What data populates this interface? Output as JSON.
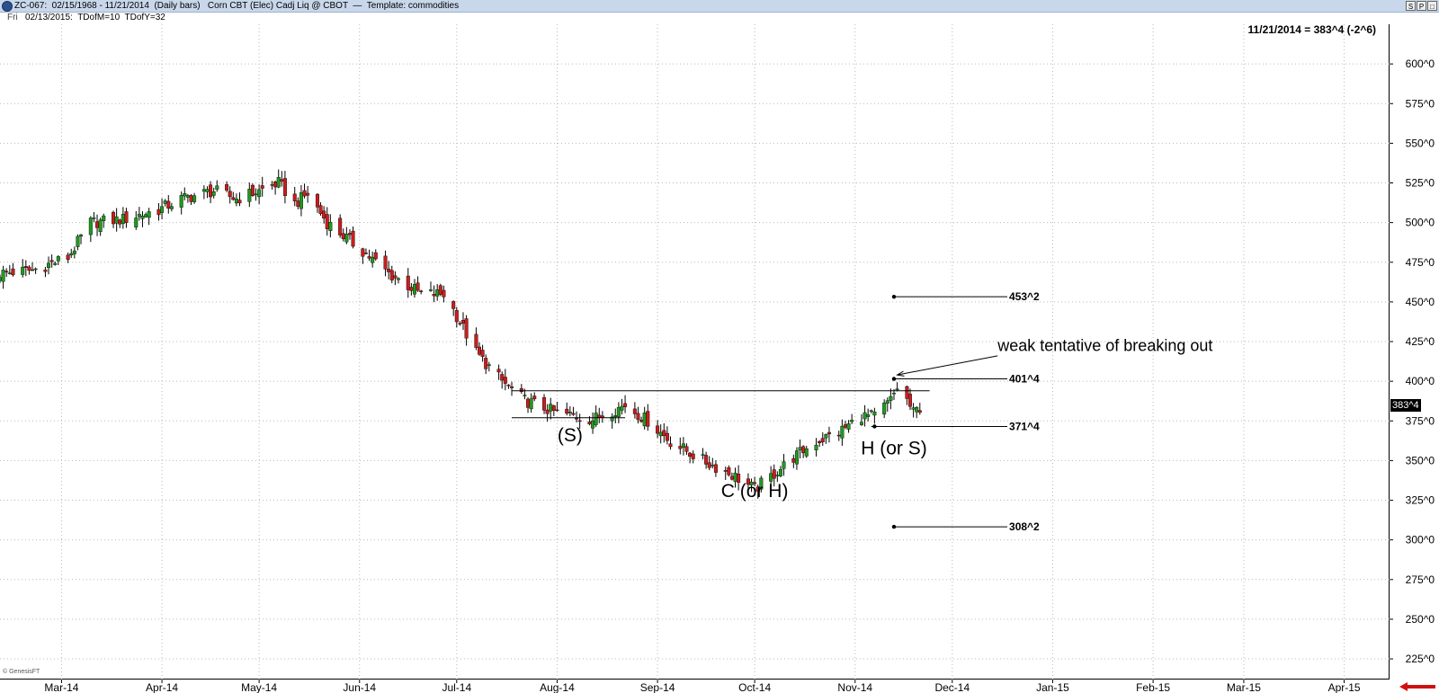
{
  "window": {
    "title": "ZC-067:  02/15/1968 - 11/21/2014  (Daily bars)   Corn CBT (Elec) Cadj Liq @ CBOT  —  Template: commodities",
    "buttons": [
      "S",
      "P",
      "□"
    ]
  },
  "infobar": {
    "day": "Fri",
    "info": "02/13/2015:  TDofM=10  TDofY=32"
  },
  "readout": "11/21/2014 = 383^4 (-2^6)",
  "watermark": "© GenesisFT",
  "last_price_tag": "383^4",
  "colors": {
    "up": "#1f9a1f",
    "down": "#c81e1e",
    "grid": "#b9b9b9",
    "line": "#000000",
    "accent_arrow": "#d01010"
  },
  "chart_data": {
    "type": "candlestick",
    "title": "",
    "xlabel": "",
    "ylabel": "",
    "ylim": [
      212,
      625
    ],
    "y_ticks": [
      "600^0",
      "575^0",
      "550^0",
      "525^0",
      "500^0",
      "475^0",
      "450^0",
      "425^0",
      "400^0",
      "375^0",
      "350^0",
      "325^0",
      "300^0",
      "275^0",
      "250^0",
      "225^0"
    ],
    "y_tick_values": [
      600,
      575,
      550,
      525,
      500,
      475,
      450,
      425,
      400,
      375,
      350,
      325,
      300,
      275,
      250,
      225
    ],
    "x_ticks": [
      "Mar-14",
      "Apr-14",
      "May-14",
      "Jun-14",
      "Jul-14",
      "Aug-14",
      "Sep-14",
      "Oct-14",
      "Nov-14",
      "Dec-14",
      "Jan-15",
      "Feb-15",
      "Mar-15",
      "Apr-15"
    ],
    "x_tick_dates": [
      "2014-03-01",
      "2014-04-01",
      "2014-05-01",
      "2014-06-01",
      "2014-07-01",
      "2014-08-01",
      "2014-09-01",
      "2014-10-01",
      "2014-11-01",
      "2014-12-01",
      "2015-01-01",
      "2015-02-01",
      "2015-03-01",
      "2015-04-01"
    ],
    "date_range": [
      "2014-02-10",
      "2015-04-15"
    ],
    "grid": true,
    "close_anchors": [
      [
        "2014-02-10",
        468
      ],
      [
        "2014-02-20",
        470
      ],
      [
        "2014-03-03",
        478
      ],
      [
        "2014-03-10",
        500
      ],
      [
        "2014-03-20",
        502
      ],
      [
        "2014-03-31",
        508
      ],
      [
        "2014-04-07",
        515
      ],
      [
        "2014-04-17",
        520
      ],
      [
        "2014-04-24",
        515
      ],
      [
        "2014-05-01",
        520
      ],
      [
        "2014-05-07",
        525
      ],
      [
        "2014-05-12",
        512
      ],
      [
        "2014-05-16",
        518
      ],
      [
        "2014-05-22",
        500
      ],
      [
        "2014-06-02",
        482
      ],
      [
        "2014-06-10",
        468
      ],
      [
        "2014-06-20",
        455
      ],
      [
        "2014-06-27",
        455
      ],
      [
        "2014-06-30",
        445
      ],
      [
        "2014-07-07",
        418
      ],
      [
        "2014-07-15",
        400
      ],
      [
        "2014-07-22",
        388
      ],
      [
        "2014-08-01",
        380
      ],
      [
        "2014-08-12",
        376
      ],
      [
        "2014-08-22",
        385
      ],
      [
        "2014-08-29",
        375
      ],
      [
        "2014-09-05",
        362
      ],
      [
        "2014-09-15",
        350
      ],
      [
        "2014-09-25",
        340
      ],
      [
        "2014-10-01",
        332
      ],
      [
        "2014-10-06",
        340
      ],
      [
        "2014-10-13",
        352
      ],
      [
        "2014-10-20",
        362
      ],
      [
        "2014-10-27",
        368
      ],
      [
        "2014-11-03",
        378
      ],
      [
        "2014-11-07",
        378
      ],
      [
        "2014-11-12",
        388
      ],
      [
        "2014-11-14",
        396
      ],
      [
        "2014-11-17",
        388
      ],
      [
        "2014-11-19",
        380
      ],
      [
        "2014-11-21",
        383.5
      ]
    ],
    "trendlines": [
      {
        "from": [
          "2014-07-18",
          394
        ],
        "to": [
          "2014-11-24",
          394
        ]
      },
      {
        "from": [
          "2014-07-18",
          377
        ],
        "to": [
          "2014-08-22",
          377
        ]
      },
      {
        "from": [
          "2014-11-06",
          371.5
        ],
        "to": [
          "2014-11-21",
          371.5
        ]
      }
    ],
    "levels": [
      {
        "label": "453^2",
        "value": 453.25,
        "start": "2014-11-13",
        "end": "2014-12-18"
      },
      {
        "label": "401^4",
        "value": 401.5,
        "start": "2014-11-13",
        "end": "2014-12-18"
      },
      {
        "label": "371^4",
        "value": 371.5,
        "start": "2014-11-07",
        "end": "2014-12-18"
      },
      {
        "label": "308^2",
        "value": 308.25,
        "start": "2014-11-13",
        "end": "2014-12-18"
      }
    ],
    "annotations": [
      {
        "text": "(S)",
        "date": "2014-08-05",
        "value": 362
      },
      {
        "text": "C (or H)",
        "date": "2014-10-01",
        "value": 327
      },
      {
        "text": "H (or S)",
        "date": "2014-11-13",
        "value": 354
      },
      {
        "text": "weak tentative of breaking out",
        "date": "2014-12-15",
        "value": 419
      }
    ],
    "arrow": {
      "from": [
        "2014-12-15",
        416
      ],
      "to": [
        "2014-11-14",
        404
      ]
    }
  }
}
